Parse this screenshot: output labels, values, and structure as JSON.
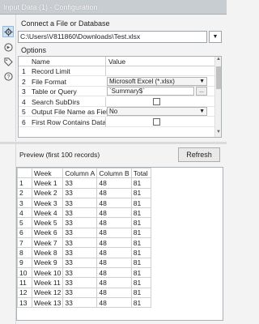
{
  "window": {
    "title": "Input Data (1) - Configuration"
  },
  "rail": {
    "icons": [
      "gear-icon",
      "tag-arrow-icon",
      "tag-icon",
      "help-icon"
    ]
  },
  "connect": {
    "label": "Connect a File or Database",
    "path": "C:\\Users\\V811860\\Downloads\\Test.xlsx"
  },
  "options": {
    "label": "Options",
    "col_name": "Name",
    "col_value": "Value",
    "rows": [
      {
        "num": "1",
        "name": "Record Limit",
        "value": ""
      },
      {
        "num": "2",
        "name": "File Format",
        "value": "Microsoft Excel (*.xlsx)"
      },
      {
        "num": "3",
        "name": "Table or Query",
        "value": "`Summary$`"
      },
      {
        "num": "4",
        "name": "Search SubDirs",
        "value": ""
      },
      {
        "num": "5",
        "name": "Output File Name as Field",
        "value": "No"
      },
      {
        "num": "6",
        "name": "First Row Contains Data",
        "value": ""
      }
    ],
    "ellipsis": "..."
  },
  "preview": {
    "label": "Preview (first 100 records)",
    "refresh": "Refresh",
    "headers": [
      "",
      "Week",
      "Column A",
      "Column B",
      "Total"
    ],
    "rows": [
      [
        "1",
        "Week 1",
        "33",
        "48",
        "81"
      ],
      [
        "2",
        "Week 2",
        "33",
        "48",
        "81"
      ],
      [
        "3",
        "Week 3",
        "33",
        "48",
        "81"
      ],
      [
        "4",
        "Week 4",
        "33",
        "48",
        "81"
      ],
      [
        "5",
        "Week 5",
        "33",
        "48",
        "81"
      ],
      [
        "6",
        "Week 6",
        "33",
        "48",
        "81"
      ],
      [
        "7",
        "Week 7",
        "33",
        "48",
        "81"
      ],
      [
        "8",
        "Week 8",
        "33",
        "48",
        "81"
      ],
      [
        "9",
        "Week 9",
        "33",
        "48",
        "81"
      ],
      [
        "10",
        "Week 10",
        "33",
        "48",
        "81"
      ],
      [
        "11",
        "Week 11",
        "33",
        "48",
        "81"
      ],
      [
        "12",
        "Week 12",
        "33",
        "48",
        "81"
      ],
      [
        "13",
        "Week 13",
        "33",
        "48",
        "81"
      ]
    ]
  }
}
